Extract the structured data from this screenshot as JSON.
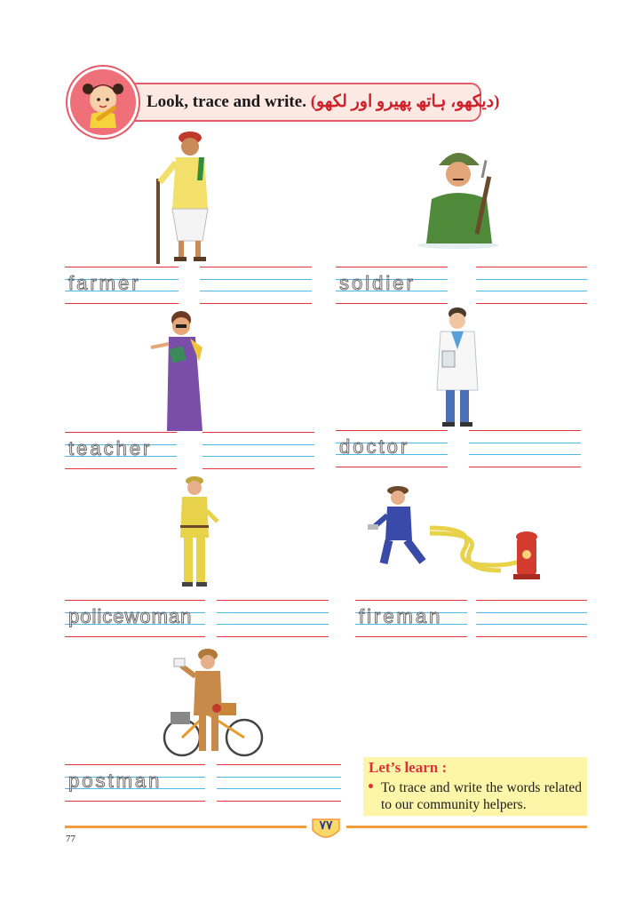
{
  "header": {
    "title": "Look, trace and write.",
    "urdu": "(دیکھو، ہاتھ پھیرو اور لکھو)"
  },
  "words": [
    {
      "id": "farmer",
      "word": "farmer"
    },
    {
      "id": "soldier",
      "word": "soldier"
    },
    {
      "id": "teacher",
      "word": "teacher"
    },
    {
      "id": "doctor",
      "word": "doctor"
    },
    {
      "id": "policewoman",
      "word": "policewoman"
    },
    {
      "id": "fireman",
      "word": "fireman"
    },
    {
      "id": "postman",
      "word": "postman"
    }
  ],
  "learn": {
    "title": "Let’s learn :",
    "text": "To trace and write the words related to our community helpers."
  },
  "footer": {
    "badge": "۷۷",
    "page_number": "77"
  },
  "colors": {
    "accent_red": "#e9343e",
    "guide_blue": "#4fb7e6",
    "footer_orange": "#f29a3c",
    "learn_bg": "#fdf6a8"
  }
}
